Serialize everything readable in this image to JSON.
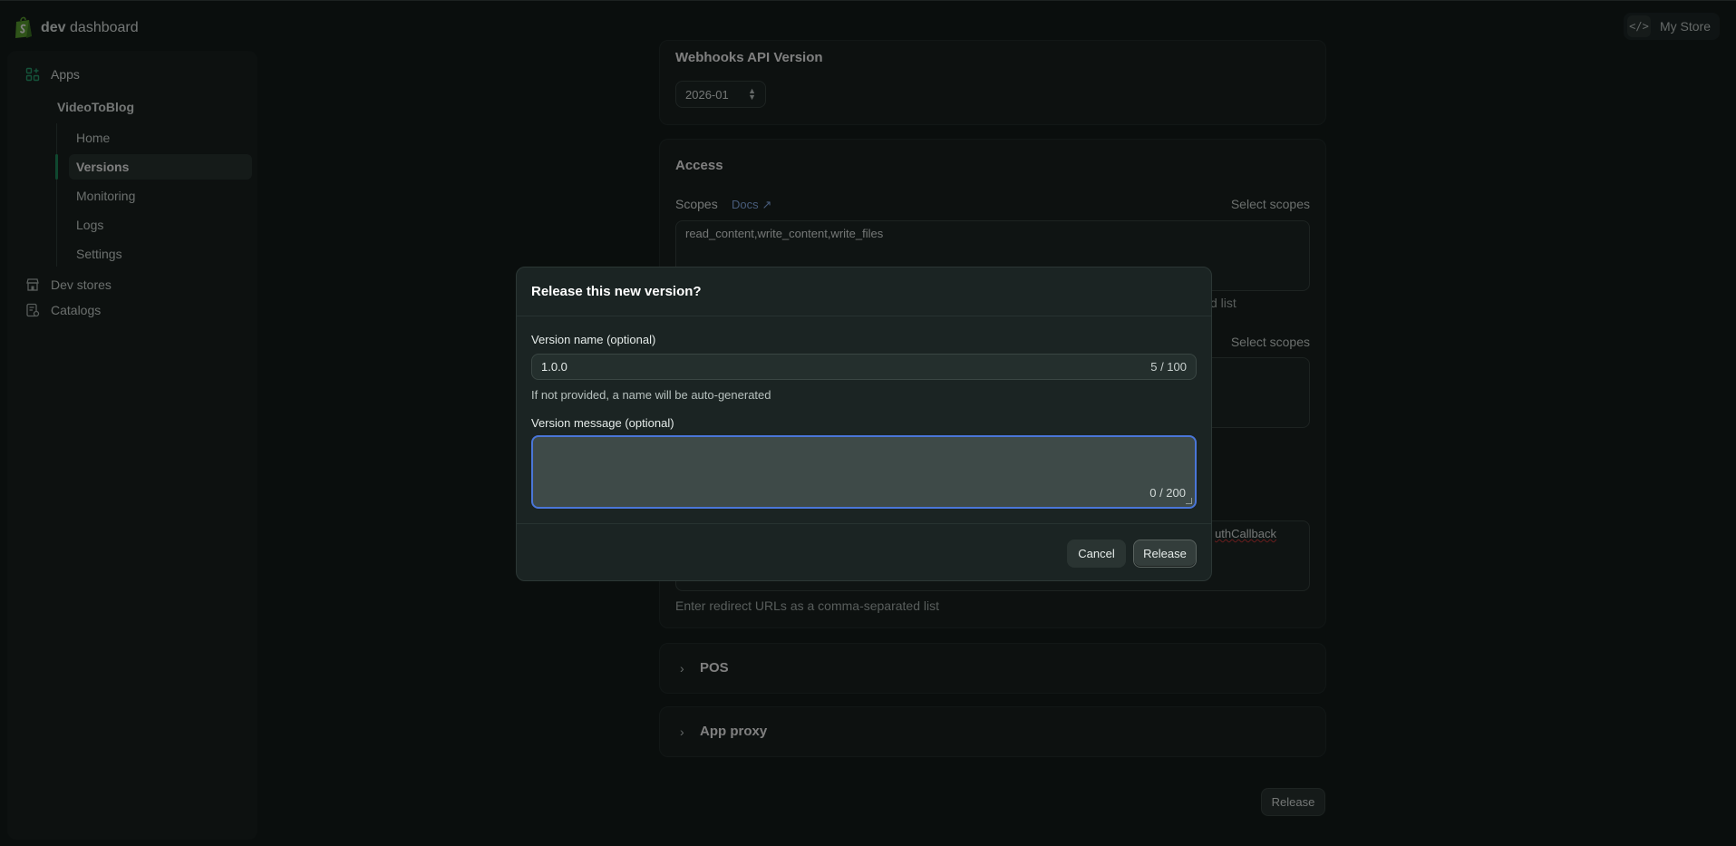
{
  "topbar": {
    "brand_bold": "dev",
    "brand_rest": " dashboard",
    "store_label": "My Store"
  },
  "sidebar": {
    "apps_label": "Apps",
    "app_name": "VideoToBlog",
    "items": [
      {
        "label": "Home",
        "active": false
      },
      {
        "label": "Versions",
        "active": true
      },
      {
        "label": "Monitoring",
        "active": false
      },
      {
        "label": "Logs",
        "active": false
      },
      {
        "label": "Settings",
        "active": false
      }
    ],
    "dev_stores_label": "Dev stores",
    "catalogs_label": "Catalogs"
  },
  "main": {
    "webhooks": {
      "title": "Webhooks API Version",
      "selected_version": "2026-01"
    },
    "access": {
      "title": "Access",
      "scopes_label": "Scopes",
      "docs_link": "Docs",
      "select_scopes_1": "Select scopes",
      "scopes_value": "read_content,write_content,write_files",
      "partial_hint": "d list",
      "select_scopes_2": "Select scopes",
      "redirect_partial": "uthCallback",
      "redirect_hint": "Enter redirect URLs as a comma-separated list"
    },
    "pos_title": "POS",
    "app_proxy_title": "App proxy",
    "release_button": "Release"
  },
  "modal": {
    "title": "Release this new version?",
    "name_label": "Version name (optional)",
    "name_value": "1.0.0",
    "name_count": "5 / 100",
    "name_help": "If not provided, a name will be auto-generated",
    "message_label": "Version message (optional)",
    "message_value": "",
    "message_count": "0 / 200",
    "cancel_label": "Cancel",
    "release_label": "Release"
  },
  "colors": {
    "accent_green": "#1f8f5f",
    "focus_blue": "#4a76d8",
    "brand_green": "#5fa832"
  }
}
